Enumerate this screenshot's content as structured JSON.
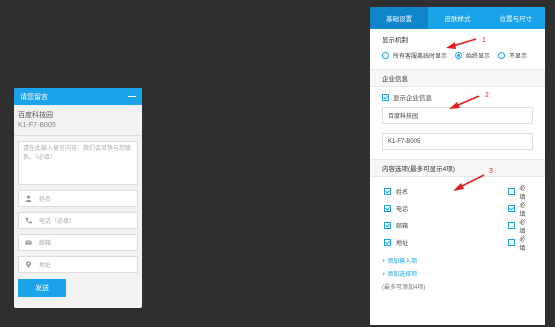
{
  "widget": {
    "header_title": "请您留言",
    "company_name": "百度科技园",
    "company_code": "K1-F7-B005",
    "message_placeholder": "请在此输入留言内容，我们会尽快与您联系。（必填）",
    "fields": [
      {
        "icon": "user-icon",
        "placeholder": "姓名"
      },
      {
        "icon": "phone-icon",
        "placeholder": "电话（必填）"
      },
      {
        "icon": "mail-icon",
        "placeholder": "邮箱"
      },
      {
        "icon": "location-pin-icon",
        "placeholder": "地址"
      }
    ],
    "send_label": "发送"
  },
  "panel": {
    "tabs": [
      {
        "label": "基础设置",
        "active": true
      },
      {
        "label": "皮肤样式",
        "active": false
      },
      {
        "label": "位置与尺寸",
        "active": false
      }
    ],
    "display_mechanism": {
      "title": "显示机制",
      "options": [
        {
          "label": "所有客服离线时显示",
          "selected": false
        },
        {
          "label": "始终显示",
          "selected": true
        },
        {
          "label": "不显示",
          "selected": false
        }
      ]
    },
    "company_info": {
      "title": "企业信息",
      "show_label": "显示企业信息",
      "show_checked": true,
      "name_value": "百度科技园",
      "code_value": "K1-F7-B005"
    },
    "content_options": {
      "title": "内容选项(最多可显示4项)",
      "items": [
        {
          "label": "姓名",
          "checked": true,
          "required_label": "必填",
          "required": false
        },
        {
          "label": "电话",
          "checked": true,
          "required_label": "必填",
          "required": true
        },
        {
          "label": "邮箱",
          "checked": true,
          "required_label": "必填",
          "required": false
        },
        {
          "label": "地址",
          "checked": true,
          "required_label": "必填",
          "required": false
        }
      ],
      "add_input_label": "+ 添加输入项",
      "add_select_label": "+ 添加选择项",
      "note": "(最多可添加4项)"
    }
  },
  "annotations": {
    "marker_1": "1",
    "marker_2": "2",
    "marker_3": "3",
    "color": "#e02020"
  },
  "colors": {
    "accent": "#1aa3e8",
    "background": "#2f2f2f"
  }
}
